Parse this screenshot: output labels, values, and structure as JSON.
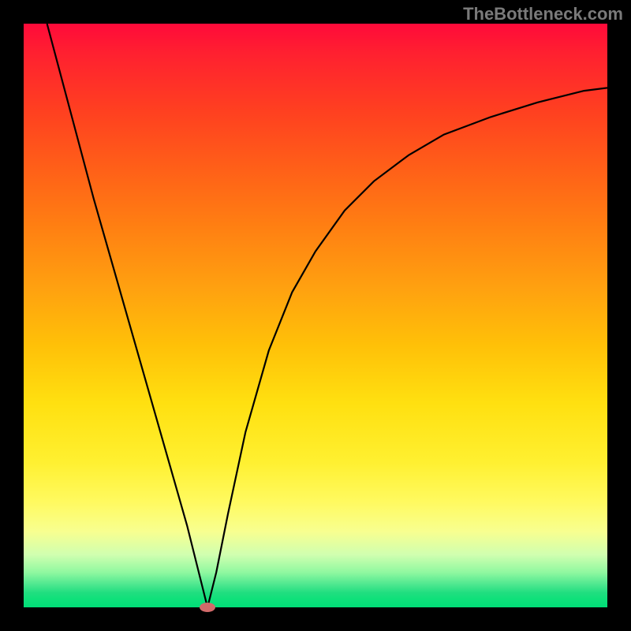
{
  "watermark": "TheBottleneck.com",
  "colors": {
    "page_bg": "#000000",
    "gradient_top": "#ff0a3a",
    "gradient_bottom": "#00de78",
    "curve": "#000000",
    "marker": "#d36a6a",
    "watermark_text": "#7a7a7a"
  },
  "chart_data": {
    "type": "line",
    "title": "",
    "xlabel": "",
    "ylabel": "",
    "xlim": [
      0,
      100
    ],
    "ylim": [
      0,
      100
    ],
    "grid": false,
    "legend": false,
    "series": [
      {
        "name": "bottleneck-curve",
        "x": [
          4,
          8,
          12,
          16,
          20,
          24,
          28,
          30,
          31.5,
          33,
          35,
          38,
          42,
          46,
          50,
          55,
          60,
          66,
          72,
          80,
          88,
          96,
          100
        ],
        "y": [
          100,
          85,
          70,
          56,
          42,
          28,
          14,
          6,
          0,
          6,
          16,
          30,
          44,
          54,
          61,
          68,
          73,
          77.5,
          81,
          84,
          86.5,
          88.5,
          89
        ]
      }
    ],
    "annotations": [
      {
        "name": "minimum-marker",
        "x": 31.5,
        "y": 0,
        "color": "#d36a6a"
      }
    ],
    "background_gradient": {
      "direction": "top-to-bottom",
      "stops": [
        {
          "pos": 0,
          "color": "#ff0a3a"
        },
        {
          "pos": 50,
          "color": "#ffc008"
        },
        {
          "pos": 82,
          "color": "#fffa60"
        },
        {
          "pos": 100,
          "color": "#00de78"
        }
      ]
    }
  }
}
